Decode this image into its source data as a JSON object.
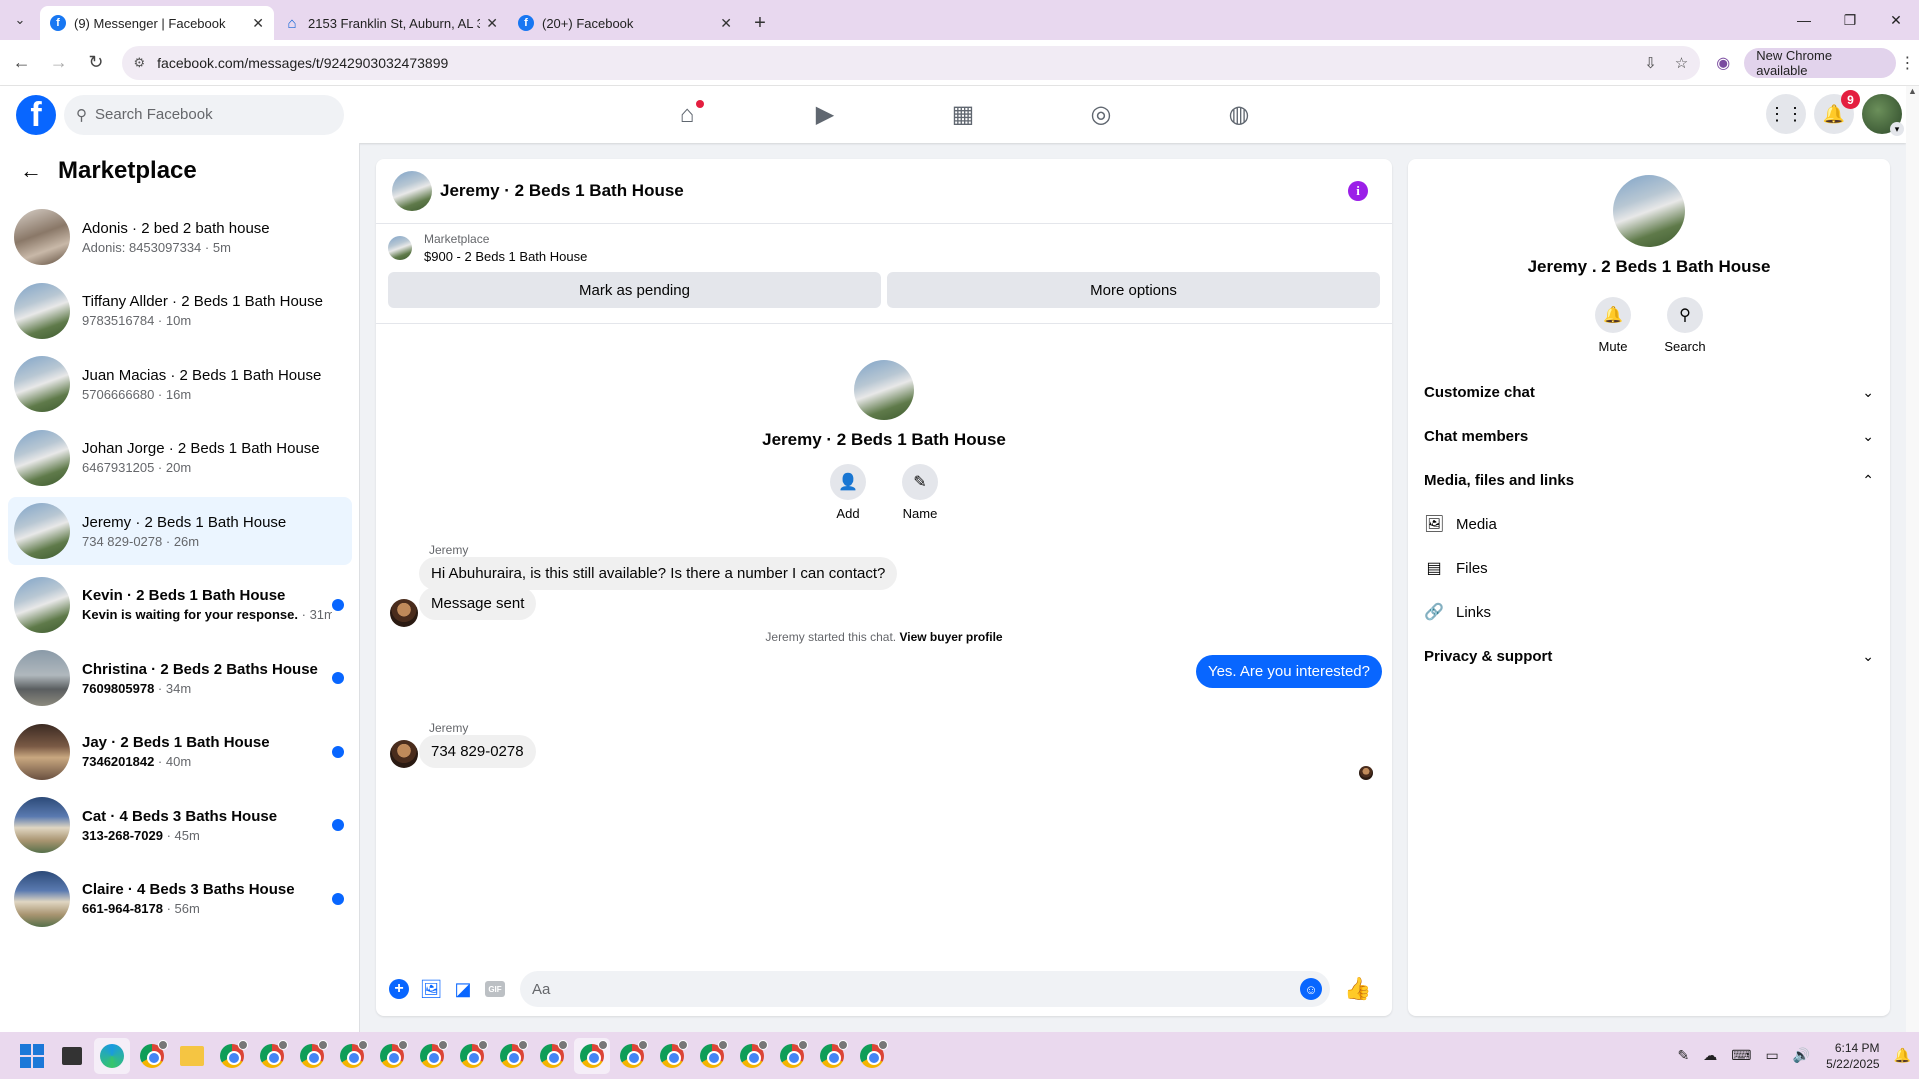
{
  "browser": {
    "tabs": [
      {
        "title": "(9) Messenger | Facebook",
        "active": true,
        "icon": "facebook-icon"
      },
      {
        "title": "2153 Franklin St, Auburn, AL 36",
        "active": false,
        "icon": "zillow-icon"
      },
      {
        "title": "(20+) Facebook",
        "active": false,
        "icon": "facebook-icon"
      }
    ],
    "url": "facebook.com/messages/t/9242903032473899",
    "new_chrome_label": "New Chrome available"
  },
  "fb": {
    "logo": "f",
    "search_placeholder": "Search Facebook",
    "nav_icons": [
      "home-icon",
      "video-icon",
      "marketplace-icon",
      "groups-icon",
      "gaming-icon"
    ],
    "notifications_count": "9"
  },
  "sidebar": {
    "title": "Marketplace",
    "conversations": [
      {
        "name": "Adonis · 2 bed 2 bath house",
        "preview": "Adonis: 8453097334",
        "time": "5m",
        "unread": false,
        "avatar": "house-e"
      },
      {
        "name": "Tiffany Allder · 2 Beds 1 Bath House",
        "preview": "9783516784",
        "time": "10m",
        "unread": false,
        "avatar": "house-a"
      },
      {
        "name": "Juan Macias · 2 Beds 1 Bath House",
        "preview": "5706666680",
        "time": "16m",
        "unread": false,
        "avatar": "house-a"
      },
      {
        "name": "Johan Jorge · 2 Beds 1 Bath House",
        "preview": "6467931205",
        "time": "20m",
        "unread": false,
        "avatar": "house-a"
      },
      {
        "name": "Jeremy · 2 Beds 1 Bath House",
        "preview": "734 829-0278",
        "time": "26m",
        "unread": false,
        "active": true,
        "avatar": "house-a"
      },
      {
        "name": "Kevin · 2 Beds 1 Bath House",
        "preview": "Kevin is waiting for your response.",
        "time": "31m",
        "unread": true,
        "avatar": "house-a"
      },
      {
        "name": "Christina · 2 Beds 2 Baths House",
        "preview": "7609805978",
        "time": "34m",
        "unread": true,
        "avatar": "house-d"
      },
      {
        "name": "Jay · 2 Beds 1 Bath House",
        "preview": "7346201842",
        "time": "40m",
        "unread": true,
        "avatar": "house-c"
      },
      {
        "name": "Cat · 4 Beds 3 Baths House",
        "preview": "313-268-7029",
        "time": "45m",
        "unread": true,
        "avatar": "house-f"
      },
      {
        "name": "Claire · 4 Beds 3 Baths House",
        "preview": "661-964-8178",
        "time": "56m",
        "unread": true,
        "avatar": "house-f"
      }
    ]
  },
  "chat": {
    "title": "Jeremy · 2 Beds 1 Bath House",
    "marketplace_label": "Marketplace",
    "listing": "$900 - 2 Beds 1 Bath House",
    "btn_pending": "Mark as pending",
    "btn_more": "More options",
    "intro_name": "Jeremy · 2 Beds 1 Bath House",
    "add_label": "Add",
    "name_label": "Name",
    "started_text": "Jeremy started this chat.",
    "started_link": "View buyer profile",
    "messages": [
      {
        "from": "Jeremy",
        "sender_label": "Jeremy",
        "text": "Hi Abuhuraira, is this still available? Is there a number I can contact?"
      },
      {
        "from": "Jeremy",
        "text": "Message sent"
      },
      {
        "from": "me",
        "text": "Yes. Are you interested?"
      },
      {
        "from": "Jeremy",
        "sender_label": "Jeremy",
        "text": "734 829-0278"
      }
    ],
    "composer_placeholder": "Aa"
  },
  "details": {
    "name": "Jeremy . 2 Beds 1 Bath House",
    "mute_label": "Mute",
    "search_label": "Search",
    "sections": {
      "customize": "Customize chat",
      "members": "Chat members",
      "media_files_links": "Media, files and links",
      "media": "Media",
      "files": "Files",
      "links": "Links",
      "privacy": "Privacy & support"
    }
  },
  "taskbar": {
    "time": "6:14 PM",
    "date": "5/22/2025"
  },
  "colors": {
    "accent": "#0866ff",
    "info": "#9b1fe8",
    "unread_dot": "#0866ff",
    "badge": "#e41e3f"
  }
}
